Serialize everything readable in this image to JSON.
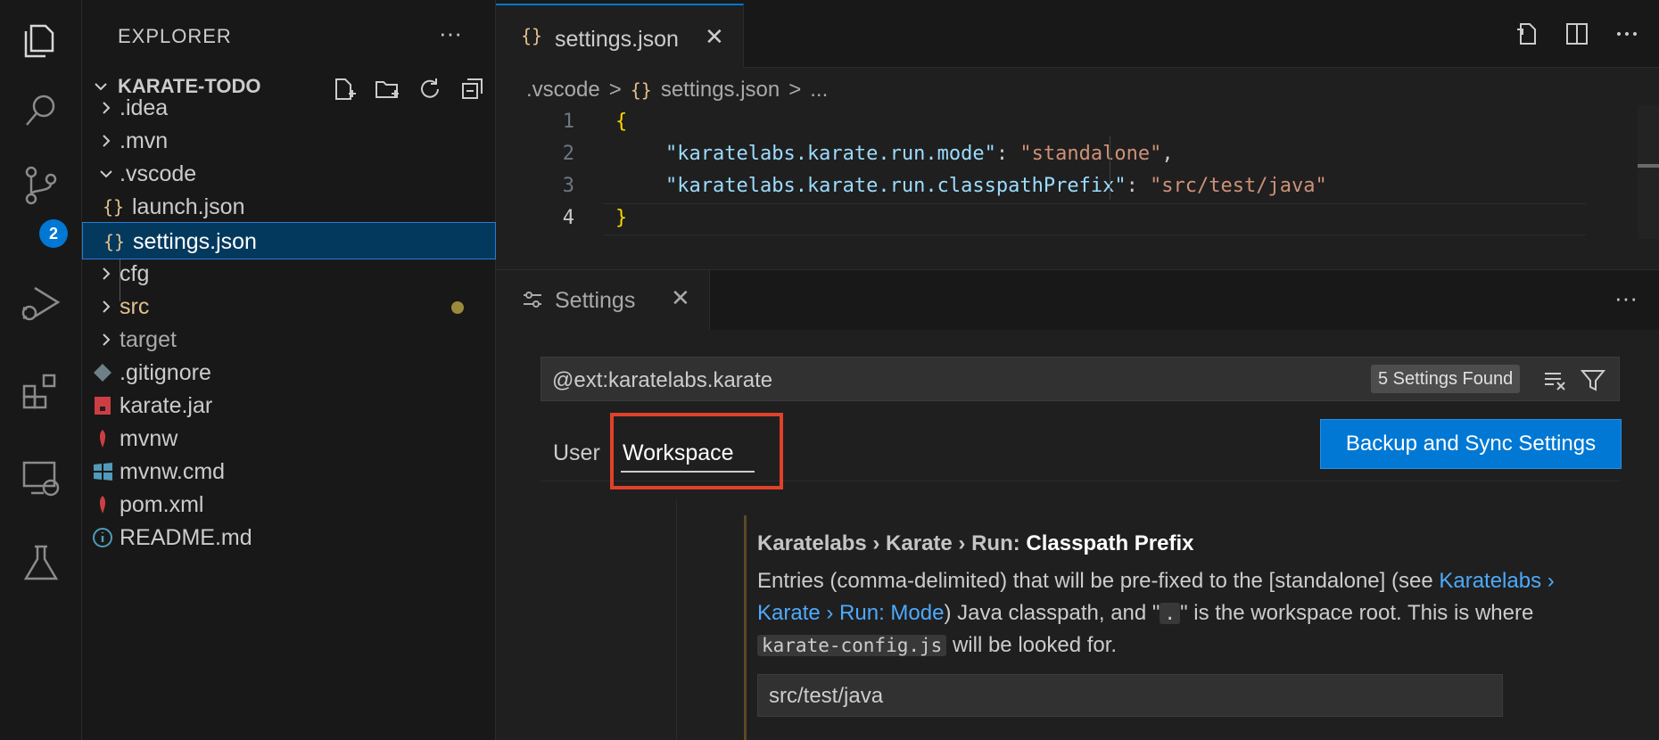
{
  "sidebar": {
    "header": "EXPLORER",
    "more": "···",
    "project": "KARATE-TODO",
    "items": [
      {
        "label": ".idea",
        "kind": "folder"
      },
      {
        "label": ".mvn",
        "kind": "folder"
      },
      {
        "label": ".vscode",
        "kind": "folder-open"
      },
      {
        "label": "launch.json",
        "kind": "json"
      },
      {
        "label": "settings.json",
        "kind": "json",
        "selected": true
      },
      {
        "label": "cfg",
        "kind": "folder"
      },
      {
        "label": "src",
        "kind": "folder",
        "modified": true
      },
      {
        "label": "target",
        "kind": "folder"
      },
      {
        "label": ".gitignore",
        "kind": "git"
      },
      {
        "label": "karate.jar",
        "kind": "jar"
      },
      {
        "label": "mvnw",
        "kind": "maven"
      },
      {
        "label": "mvnw.cmd",
        "kind": "windows"
      },
      {
        "label": "pom.xml",
        "kind": "maven"
      },
      {
        "label": "README.md",
        "kind": "info"
      }
    ]
  },
  "activity": {
    "source_control_badge": "2"
  },
  "editor": {
    "tab_icon": "{}",
    "tab_label": "settings.json",
    "tab_close": "✕",
    "breadcrumb": {
      "folder": ".vscode",
      "sep": ">",
      "file_icon": "{}",
      "file": "settings.json",
      "tail": "..."
    },
    "lines": [
      {
        "n": "1",
        "open": "{"
      },
      {
        "n": "2",
        "key": "\"karatelabs.karate.run.mode\"",
        "colon": ": ",
        "value": "\"standalone\"",
        "comma": ","
      },
      {
        "n": "3",
        "key": "\"karatelabs.karate.run.classpathPrefix\"",
        "colon": ": ",
        "value": "\"src/test/java\"",
        "comma": ""
      },
      {
        "n": "4",
        "close": "}"
      }
    ]
  },
  "settings": {
    "tab_label": "Settings",
    "tab_close": "✕",
    "more": "···",
    "search_value": "@ext:karatelabs.karate",
    "found": "5 Settings Found",
    "scope_user": "User",
    "scope_workspace": "Workspace",
    "sync_button": "Backup and Sync Settings",
    "item": {
      "title_prefix": "Karatelabs › Karate › Run: ",
      "title_name": "Classpath Prefix",
      "desc_1": "Entries (comma-delimited) that will be pre-fixed to the [standalone] (see ",
      "desc_link": "Karatelabs › Karate › Run: Mode",
      "desc_2": ") Java classpath, and \"",
      "desc_chip_1": ".",
      "desc_3": "\" is the workspace root. This is where ",
      "desc_chip_2": "karate-config.js",
      "desc_4": " will be looked for.",
      "value": "src/test/java"
    }
  },
  "colors": {
    "accent": "#0078d4",
    "highlight": "#e0412b",
    "selected_bg": "#04395e"
  }
}
